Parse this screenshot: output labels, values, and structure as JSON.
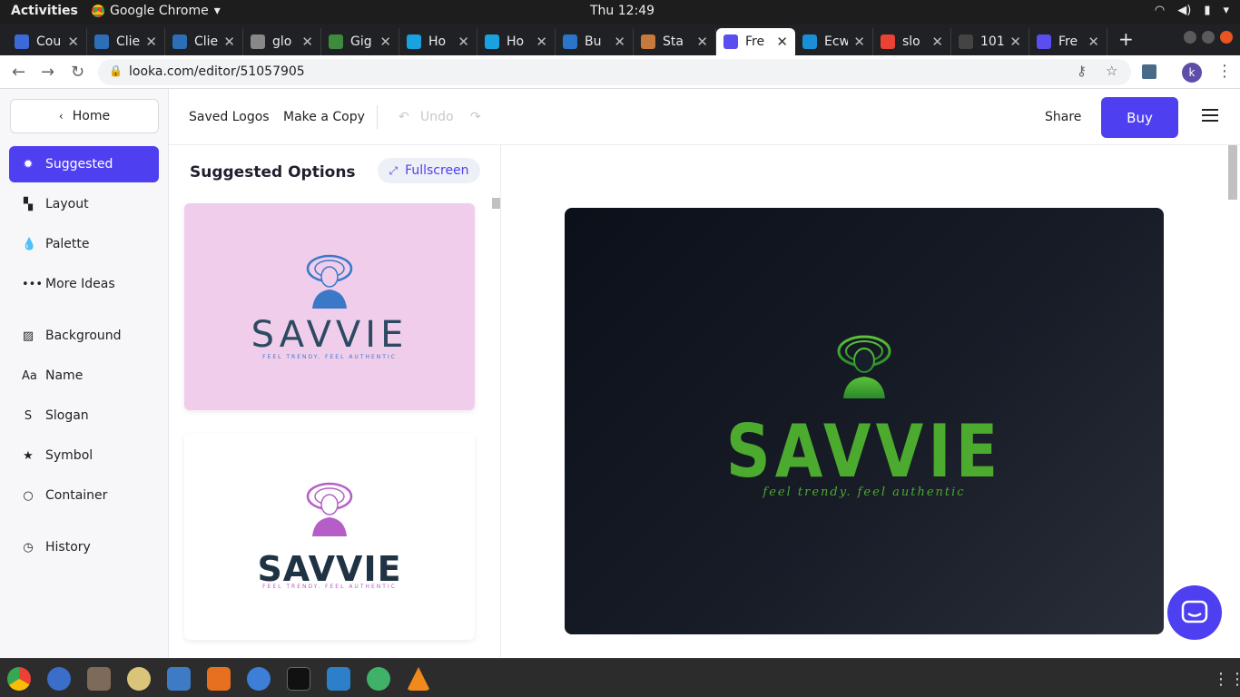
{
  "system": {
    "activities": "Activities",
    "app_name": "Google Chrome",
    "clock": "Thu 12:49"
  },
  "tabs": [
    {
      "title": "Cou",
      "color": "#3b6ad8"
    },
    {
      "title": "Clie",
      "color": "#2d6fb7"
    },
    {
      "title": "Clie",
      "color": "#2d6fb7"
    },
    {
      "title": "glo",
      "color": "#888888"
    },
    {
      "title": "Gig",
      "color": "#3e8b3e"
    },
    {
      "title": "Ho",
      "color": "#1aa1e0"
    },
    {
      "title": "Ho",
      "color": "#1aa1e0"
    },
    {
      "title": "Bu",
      "color": "#2a74c9"
    },
    {
      "title": "Sta",
      "color": "#c77a3c"
    },
    {
      "title": "Fre",
      "color": "#5b4ef0",
      "active": true
    },
    {
      "title": "Ecw",
      "color": "#1a8fd6"
    },
    {
      "title": "slo",
      "color": "#ea4335"
    },
    {
      "title": "101",
      "color": "#444444"
    },
    {
      "title": "Fre",
      "color": "#5b4ef0"
    }
  ],
  "browser": {
    "url": "looka.com/editor/51057905",
    "profile_initial": "k"
  },
  "sidebar": {
    "home": "Home",
    "items": [
      {
        "label": "Suggested",
        "icon": "lightbulb-icon",
        "glyph": "✹"
      },
      {
        "label": "Layout",
        "icon": "layout-icon",
        "glyph": "▚"
      },
      {
        "label": "Palette",
        "icon": "drop-icon",
        "glyph": "💧"
      },
      {
        "label": "More Ideas",
        "icon": "more-icon",
        "glyph": "•••"
      },
      {
        "label": "Background",
        "icon": "background-icon",
        "glyph": "▨"
      },
      {
        "label": "Name",
        "icon": "name-icon",
        "glyph": "Aa"
      },
      {
        "label": "Slogan",
        "icon": "slogan-icon",
        "glyph": "S"
      },
      {
        "label": "Symbol",
        "icon": "star-icon",
        "glyph": "★"
      },
      {
        "label": "Container",
        "icon": "circle-icon",
        "glyph": "○"
      },
      {
        "label": "History",
        "icon": "clock-icon",
        "glyph": "◷"
      }
    ]
  },
  "toolbar": {
    "saved_logos": "Saved Logos",
    "make_copy": "Make a Copy",
    "undo": "Undo",
    "share": "Share",
    "buy": "Buy"
  },
  "options": {
    "title": "Suggested Options",
    "fullscreen": "Fullscreen",
    "cards": [
      {
        "name": "SAVVIE",
        "slogan": "FEEL TRENDY. FEEL AUTHENTIC",
        "bg": "#f0cdeb",
        "name_color": "#2d4a63",
        "icon_color": "#3b78c8"
      },
      {
        "name": "SAVVIE",
        "slogan": "FEEL TRENDY. FEEL AUTHENTIC",
        "bg": "#ffffff",
        "name_color": "#1f3344",
        "icon_color": "#b65ec8"
      }
    ]
  },
  "preview": {
    "name": "SAVVIE",
    "slogan": "feel trendy. feel authentic",
    "accent": "#4caa2e"
  },
  "colors": {
    "brand": "#4e40f0"
  }
}
